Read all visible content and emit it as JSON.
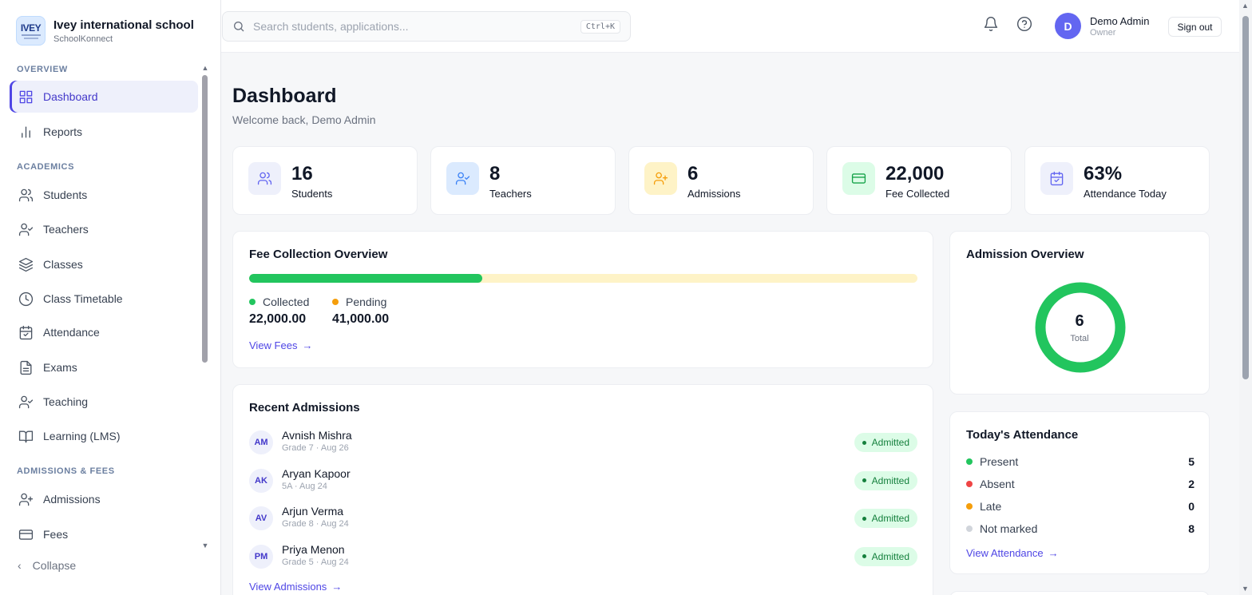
{
  "brand": {
    "name": "Ivey international school",
    "sub": "SchoolKonnect",
    "logo_text": "IVEY"
  },
  "sections": {
    "overview": "OVERVIEW",
    "academics": "ACADEMICS",
    "admissions_fees": "ADMISSIONS & FEES"
  },
  "nav": {
    "dashboard": "Dashboard",
    "reports": "Reports",
    "students": "Students",
    "teachers": "Teachers",
    "classes": "Classes",
    "timetable": "Class Timetable",
    "attendance": "Attendance",
    "exams": "Exams",
    "teaching": "Teaching",
    "lms": "Learning (LMS)",
    "admissions": "Admissions",
    "fees": "Fees"
  },
  "collapse_label": "Collapse",
  "search": {
    "placeholder": "Search students, applications...",
    "shortcut": "Ctrl+K"
  },
  "user": {
    "initial": "D",
    "name": "Demo Admin",
    "role": "Owner",
    "signout": "Sign out"
  },
  "page": {
    "title": "Dashboard",
    "welcome": "Welcome back, Demo Admin"
  },
  "stats": [
    {
      "value": "16",
      "label": "Students",
      "icon": "users-icon",
      "color": "#6366f1",
      "bg": "#eef0fb"
    },
    {
      "value": "8",
      "label": "Teachers",
      "icon": "user-check-icon",
      "color": "#3b82f6",
      "bg": "#dbeafe"
    },
    {
      "value": "6",
      "label": "Admissions",
      "icon": "user-plus-icon",
      "color": "#f59e0b",
      "bg": "#fef3c7"
    },
    {
      "value": "22,000",
      "label": "Fee Collected",
      "icon": "credit-card-icon",
      "color": "#16a34a",
      "bg": "#dcfce7"
    },
    {
      "value": "63%",
      "label": "Attendance Today",
      "icon": "calendar-check-icon",
      "color": "#6366f1",
      "bg": "#eef0fb"
    }
  ],
  "fee_overview": {
    "title": "Fee Collection Overview",
    "collected_label": "Collected",
    "collected_value": "22,000.00",
    "pending_label": "Pending",
    "pending_value": "41,000.00",
    "collected_fraction": 0.349,
    "link": "View Fees"
  },
  "recent_admissions": {
    "title": "Recent Admissions",
    "items": [
      {
        "initials": "AM",
        "name": "Avnish Mishra",
        "meta": "Grade 7 · Aug 26",
        "status": "Admitted"
      },
      {
        "initials": "AK",
        "name": "Aryan Kapoor",
        "meta": "5A · Aug 24",
        "status": "Admitted"
      },
      {
        "initials": "AV",
        "name": "Arjun Verma",
        "meta": "Grade 8 · Aug 24",
        "status": "Admitted"
      },
      {
        "initials": "PM",
        "name": "Priya Menon",
        "meta": "Grade 5 · Aug 24",
        "status": "Admitted"
      }
    ],
    "link": "View Admissions"
  },
  "admission_overview": {
    "title": "Admission Overview",
    "total": "6",
    "total_label": "Total",
    "color": "#22c55e"
  },
  "todays_attendance": {
    "title": "Today's Attendance",
    "rows": [
      {
        "label": "Present",
        "value": "5",
        "color": "#22c55e"
      },
      {
        "label": "Absent",
        "value": "2",
        "color": "#ef4444"
      },
      {
        "label": "Late",
        "value": "0",
        "color": "#f59e0b"
      },
      {
        "label": "Not marked",
        "value": "8",
        "color": "#d1d5db"
      }
    ],
    "link": "View Attendance"
  }
}
